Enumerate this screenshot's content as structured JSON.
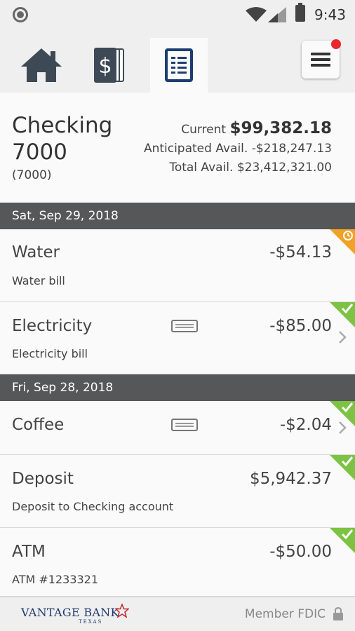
{
  "status_bar": {
    "time": "9:43",
    "icons": [
      "notification-dot-icon",
      "wifi-icon",
      "signal-icon",
      "battery-icon"
    ]
  },
  "nav": {
    "tabs": [
      {
        "name": "home",
        "icon": "home-icon",
        "active": false
      },
      {
        "name": "accounts",
        "icon": "dollar-cards-icon",
        "active": false
      },
      {
        "name": "transactions",
        "icon": "document-list-icon",
        "active": true
      }
    ],
    "menu_icon": "hamburger-menu-icon",
    "menu_badge": true
  },
  "account": {
    "name": "Checking 7000",
    "number": "(7000)",
    "current_label": "Current",
    "current_value": "$99,382.18",
    "anticipated_label": "Anticipated Avail.",
    "anticipated_value": "-$218,247.13",
    "total_label": "Total Avail.",
    "total_value": "$23,412,321.00"
  },
  "groups": [
    {
      "date": "Sat, Sep 29, 2018",
      "transactions": [
        {
          "name": "Water",
          "description": "Water bill",
          "amount": "-$54.13",
          "status": "pending",
          "receipt": false,
          "chevron": false
        },
        {
          "name": "Electricity",
          "description": "Electricity bill",
          "amount": "-$85.00",
          "status": "cleared",
          "receipt": true,
          "chevron": true
        }
      ]
    },
    {
      "date": "Fri, Sep 28, 2018",
      "transactions": [
        {
          "name": "Coffee",
          "description": "",
          "amount": "-$2.04",
          "status": "cleared",
          "receipt": true,
          "chevron": true
        },
        {
          "name": "Deposit",
          "description": "Deposit to Checking account",
          "amount": "$5,942.37",
          "status": "cleared",
          "receipt": false,
          "chevron": false
        },
        {
          "name": "ATM",
          "description": "ATM #1233321",
          "amount": "-$50.00",
          "status": "cleared",
          "receipt": false,
          "chevron": false
        }
      ]
    }
  ],
  "footer": {
    "brand_name": "VANTAGE BANK",
    "brand_sub": "TEXAS",
    "fdic_text": "Member FDIC"
  },
  "colors": {
    "date_header_bg": "#555759",
    "cleared": "#7cc243",
    "pending": "#f0a128",
    "brand": "#1f3a6e",
    "nav_icon": "#3d4a55",
    "badge": "#e8262b"
  }
}
